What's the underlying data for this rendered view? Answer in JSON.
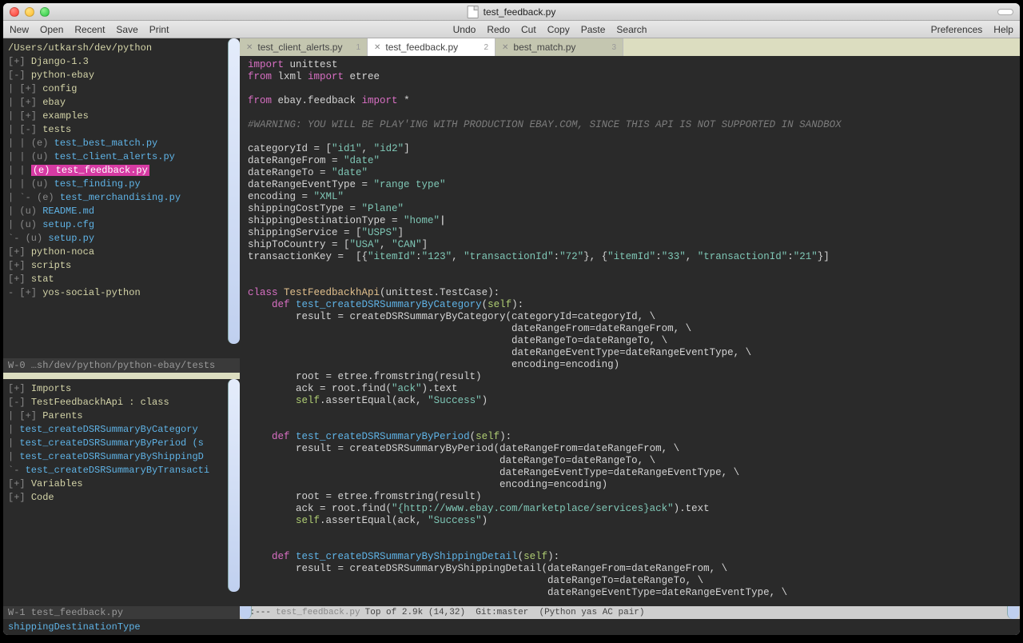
{
  "title": "test_feedback.py",
  "menubar": {
    "left": [
      "New",
      "Open",
      "Recent",
      "Save",
      "Print"
    ],
    "center": [
      "Undo",
      "Redo",
      "Cut",
      "Copy",
      "Paste",
      "Search"
    ],
    "right": [
      "Preferences",
      "Help"
    ]
  },
  "sidebar": {
    "top_status": "W-0 …sh/dev/python/python-ebay/tests",
    "root": "/Users/utkarsh/dev/python",
    "tree": [
      {
        "i": 1,
        "m": "[+]",
        "t": "Django-1.3",
        "d": true
      },
      {
        "i": 1,
        "m": "[-]",
        "t": "python-ebay",
        "d": true
      },
      {
        "i": 2,
        "m": "[+]",
        "t": "config",
        "d": true,
        "p": "|  "
      },
      {
        "i": 2,
        "m": "[+]",
        "t": "ebay",
        "d": true,
        "p": "|  "
      },
      {
        "i": 2,
        "m": "[+]",
        "t": "examples",
        "d": true,
        "p": "|  "
      },
      {
        "i": 2,
        "m": "[-]",
        "t": "tests",
        "d": true,
        "p": "|  "
      },
      {
        "i": 3,
        "m": "(e)",
        "t": "test_best_match.py",
        "p": "|  |  "
      },
      {
        "i": 3,
        "m": "(u)",
        "t": "test_client_alerts.py",
        "p": "|  |  "
      },
      {
        "i": 3,
        "m": "(e)",
        "t": "test_feedback.py",
        "p": "|  |  ",
        "hl": true
      },
      {
        "i": 3,
        "m": "(u)",
        "t": "test_finding.py",
        "p": "|  |  "
      },
      {
        "i": 3,
        "m": "(e)",
        "t": "test_merchandising.py",
        "p": "|  `- "
      },
      {
        "i": 2,
        "m": "(u)",
        "t": "README.md",
        "p": "|  "
      },
      {
        "i": 2,
        "m": "(u)",
        "t": "setup.cfg",
        "p": "|  "
      },
      {
        "i": 2,
        "m": "(u)",
        "t": "setup.py",
        "p": "`- "
      },
      {
        "i": 1,
        "m": "[+]",
        "t": "python-noca",
        "d": true
      },
      {
        "i": 1,
        "m": "[+]",
        "t": "scripts",
        "d": true
      },
      {
        "i": 1,
        "m": "[+]",
        "t": "stat",
        "d": true
      },
      {
        "i": 0,
        "m": "[+]",
        "t": "yos-social-python",
        "d": true,
        "p": "-  "
      }
    ],
    "outline_title": "W-1 test_feedback.py",
    "outline": [
      {
        "m": "[+]",
        "t": "Imports",
        "y": true
      },
      {
        "m": "[-]",
        "t": "TestFeedbackhApi : class",
        "y": true
      },
      {
        "m": "[+]",
        "t": "Parents",
        "y": true,
        "p": "|  "
      },
      {
        "m": "",
        "t": "test_createDSRSummaryByCategory",
        "b": true,
        "p": "|  "
      },
      {
        "m": "",
        "t": "test_createDSRSummaryByPeriod (s",
        "b": true,
        "p": "|  "
      },
      {
        "m": "",
        "t": "test_createDSRSummaryByShippingD",
        "b": true,
        "p": "|  "
      },
      {
        "m": "",
        "t": "test_createDSRSummaryByTransacti",
        "b": true,
        "p": "`- "
      },
      {
        "m": "[+]",
        "t": "Variables",
        "y": true
      },
      {
        "m": "[+]",
        "t": "Code",
        "y": true
      }
    ],
    "minibuffer": "shippingDestinationType"
  },
  "tabs": [
    {
      "label": "test_client_alerts.py",
      "badge": "1",
      "active": false
    },
    {
      "label": "test_feedback.py",
      "badge": "2",
      "active": true
    },
    {
      "label": "best_match.py",
      "badge": "3",
      "active": false
    }
  ],
  "mode_line": {
    "prefix": "-:---",
    "file": "test_feedback.py",
    "pos": "Top of 2.9k (14,32)",
    "git": "Git:master",
    "modes": "(Python yas AC pair)"
  },
  "code": {
    "l1a": "import",
    "l1b": " unittest",
    "l2a": "from",
    "l2b": " lxml ",
    "l2c": "import",
    "l2d": " etree",
    "l3a": "from",
    "l3b": " ebay.feedback ",
    "l3c": "import",
    "l3d": " *",
    "l4": "#WARNING: YOU WILL BE PLAY'ING WITH PRODUCTION EBAY.COM, SINCE THIS API IS NOT SUPPORTED IN SANDBOX",
    "l5a": "categoryId = [",
    "l5b": "\"id1\"",
    "l5c": ", ",
    "l5d": "\"id2\"",
    "l5e": "]",
    "l6a": "dateRangeFrom = ",
    "l6b": "\"date\"",
    "l7a": "dateRangeTo = ",
    "l7b": "\"date\"",
    "l8a": "dateRangeEventType = ",
    "l8b": "\"range type\"",
    "l9a": "encoding = ",
    "l9b": "\"XML\"",
    "l10a": "shippingCostType = ",
    "l10b": "\"Plane\"",
    "l11a": "shippingDestinationType = ",
    "l11b": "\"home\"",
    "l12a": "shippingService = [",
    "l12b": "\"USPS\"",
    "l12c": "]",
    "l13a": "shipToCountry = [",
    "l13b": "\"USA\"",
    "l13c": ", ",
    "l13d": "\"CAN\"",
    "l13e": "]",
    "l14a": "transactionKey =  [{",
    "l14b": "\"itemId\"",
    "l14c": ":",
    "l14d": "\"123\"",
    "l14e": ", ",
    "l14f": "\"transactionId\"",
    "l14g": ":",
    "l14h": "\"72\"",
    "l14i": "}, {",
    "l14j": "\"itemId\"",
    "l14k": ":",
    "l14l": "\"33\"",
    "l14m": ", ",
    "l14n": "\"transactionId\"",
    "l14o": ":",
    "l14p": "\"21\"",
    "l14q": "}]",
    "cls1a": "class",
    "cls1b": " TestFeedbackhApi",
    "cls1c": "(unittest.TestCase):",
    "d1a": "def",
    "d1b": " test_createDSRSummaryByCategory",
    "d1c": "(",
    "d1d": "self",
    "d1e": "):",
    "r1": "        result = createDSRSummaryByCategory(categoryId=categoryId, \\",
    "r2": "                                            dateRangeFrom=dateRangeFrom, \\",
    "r3": "                                            dateRangeTo=dateRangeTo, \\",
    "r4": "                                            dateRangeEventType=dateRangeEventType, \\",
    "r5": "                                            encoding=encoding)",
    "r6": "        root = etree.fromstring(result)",
    "r7a": "        ack = root.find(",
    "r7b": "\"ack\"",
    "r7c": ").text",
    "r8a": "        ",
    "r8b": "self",
    "r8c": ".assertEqual(ack, ",
    "r8d": "\"Success\"",
    "r8e": ")",
    "d2a": "def",
    "d2b": " test_createDSRSummaryByPeriod",
    "d2c": "(",
    "d2d": "self",
    "d2e": "):",
    "p1": "        result = createDSRSummaryByPeriod(dateRangeFrom=dateRangeFrom, \\",
    "p2": "                                          dateRangeTo=dateRangeTo, \\",
    "p3": "                                          dateRangeEventType=dateRangeEventType, \\",
    "p4": "                                          encoding=encoding)",
    "p5": "        root = etree.fromstring(result)",
    "p6a": "        ack = root.find(",
    "p6b": "\"{http://www.ebay.com/marketplace/services}ack\"",
    "p6c": ").text",
    "p7a": "        ",
    "p7b": "self",
    "p7c": ".assertEqual(ack, ",
    "p7d": "\"Success\"",
    "p7e": ")",
    "d3a": "def",
    "d3b": " test_createDSRSummaryByShippingDetail",
    "d3c": "(",
    "d3d": "self",
    "d3e": "):",
    "s1": "        result = createDSRSummaryByShippingDetail(dateRangeFrom=dateRangeFrom, \\",
    "s2": "                                                  dateRangeTo=dateRangeTo, \\",
    "s3": "                                                  dateRangeEventType=dateRangeEventType, \\"
  }
}
